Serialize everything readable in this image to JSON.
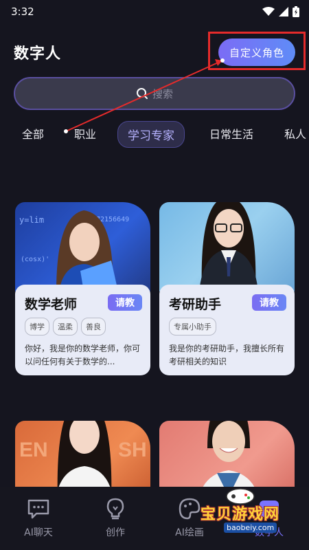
{
  "status_bar": {
    "time": "3:32"
  },
  "header": {
    "title": "数字人",
    "custom_button": "自定义角色"
  },
  "search": {
    "placeholder": "搜索"
  },
  "tabs": [
    "全部",
    "职业",
    "学习专家",
    "日常生活",
    "私人"
  ],
  "cards": [
    {
      "title": "数学老师",
      "button": "请教",
      "tags": [
        "博学",
        "温柔",
        "善良"
      ],
      "description": "你好，我是你的数学老师，你可以问任何有关于数学的..."
    },
    {
      "title": "考研助手",
      "button": "请教",
      "tags": [
        "专属小助手"
      ],
      "description": "我是你的考研助手，我擅长所有考研相关的知识"
    }
  ],
  "bottom_nav": [
    "AI聊天",
    "创作",
    "AI绘画",
    "数字人"
  ],
  "watermark": {
    "title": "宝贝游戏网",
    "url": "baobeiy.com"
  },
  "colors": {
    "accent": "#7b6cf5",
    "highlight": "#e52b2b",
    "background": "#15151f"
  }
}
